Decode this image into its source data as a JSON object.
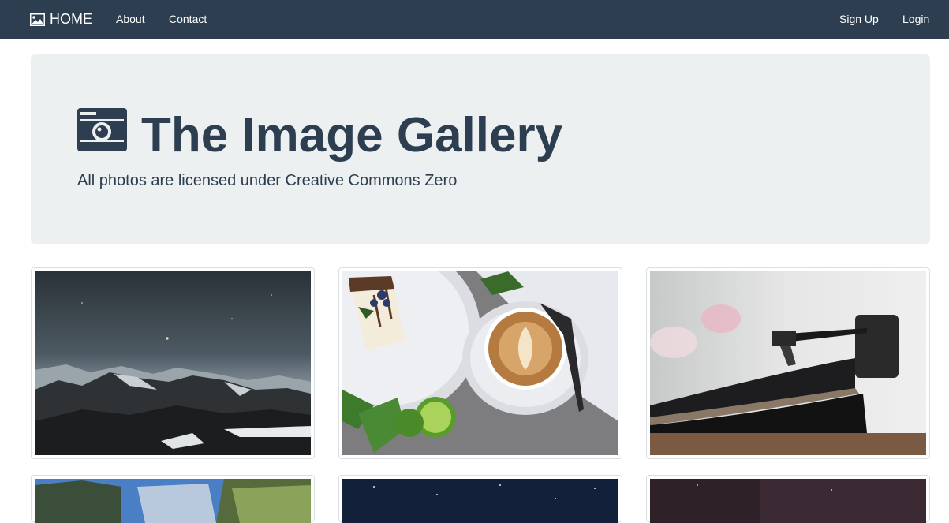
{
  "navbar": {
    "brand_label": "HOME",
    "brand_icon": "picture-icon",
    "links": [
      "About",
      "Contact"
    ],
    "right_links": [
      "Sign Up",
      "Login"
    ]
  },
  "hero": {
    "title": "The Image Gallery",
    "title_icon": "camera-icon",
    "subtitle": "All photos are licensed under Creative Commons Zero"
  },
  "gallery": {
    "thumbnails": [
      {
        "subject": "mountains-night-sky"
      },
      {
        "subject": "coffee-and-cake"
      },
      {
        "subject": "record-player"
      },
      {
        "subject": "landscape-partial"
      },
      {
        "subject": "starry-sky-partial"
      },
      {
        "subject": "dusk-partial"
      }
    ]
  },
  "colors": {
    "navbar_bg": "#2c3e50",
    "jumbotron_bg": "#ecf0f1",
    "text_primary": "#2c3e50"
  }
}
